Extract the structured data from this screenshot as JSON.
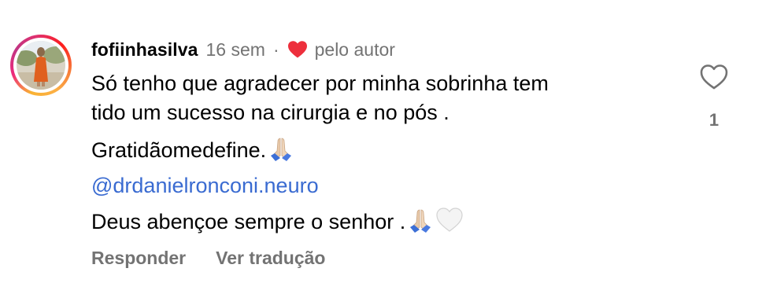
{
  "comment": {
    "username": "fofiinhasilva",
    "time": "16 sem",
    "separator": "·",
    "liked_by_author_label": "pelo autor",
    "lines": [
      "Só tenho que agradecer por minha sobrinha tem",
      "tido um sucesso na cirurgia e no pós .",
      "Gratidãomedefine.",
      "@drdanielronconi.neuro",
      "Deus abençoe sempre o senhor ."
    ],
    "emojis": {
      "line3": [
        "folded-hands-emoji"
      ],
      "line5": [
        "folded-hands-emoji",
        "white-heart-emoji"
      ]
    },
    "mention_color": "#3a6bd1",
    "like_count": "1"
  },
  "actions": {
    "reply_label": "Responder",
    "translate_label": "Ver tradução"
  },
  "colors": {
    "secondary_text": "#737373",
    "heart_red": "#ed2f3c",
    "text": "#000000"
  },
  "icons": {
    "liked_heart": "red-heart-icon",
    "like": "heart-outline-icon"
  }
}
